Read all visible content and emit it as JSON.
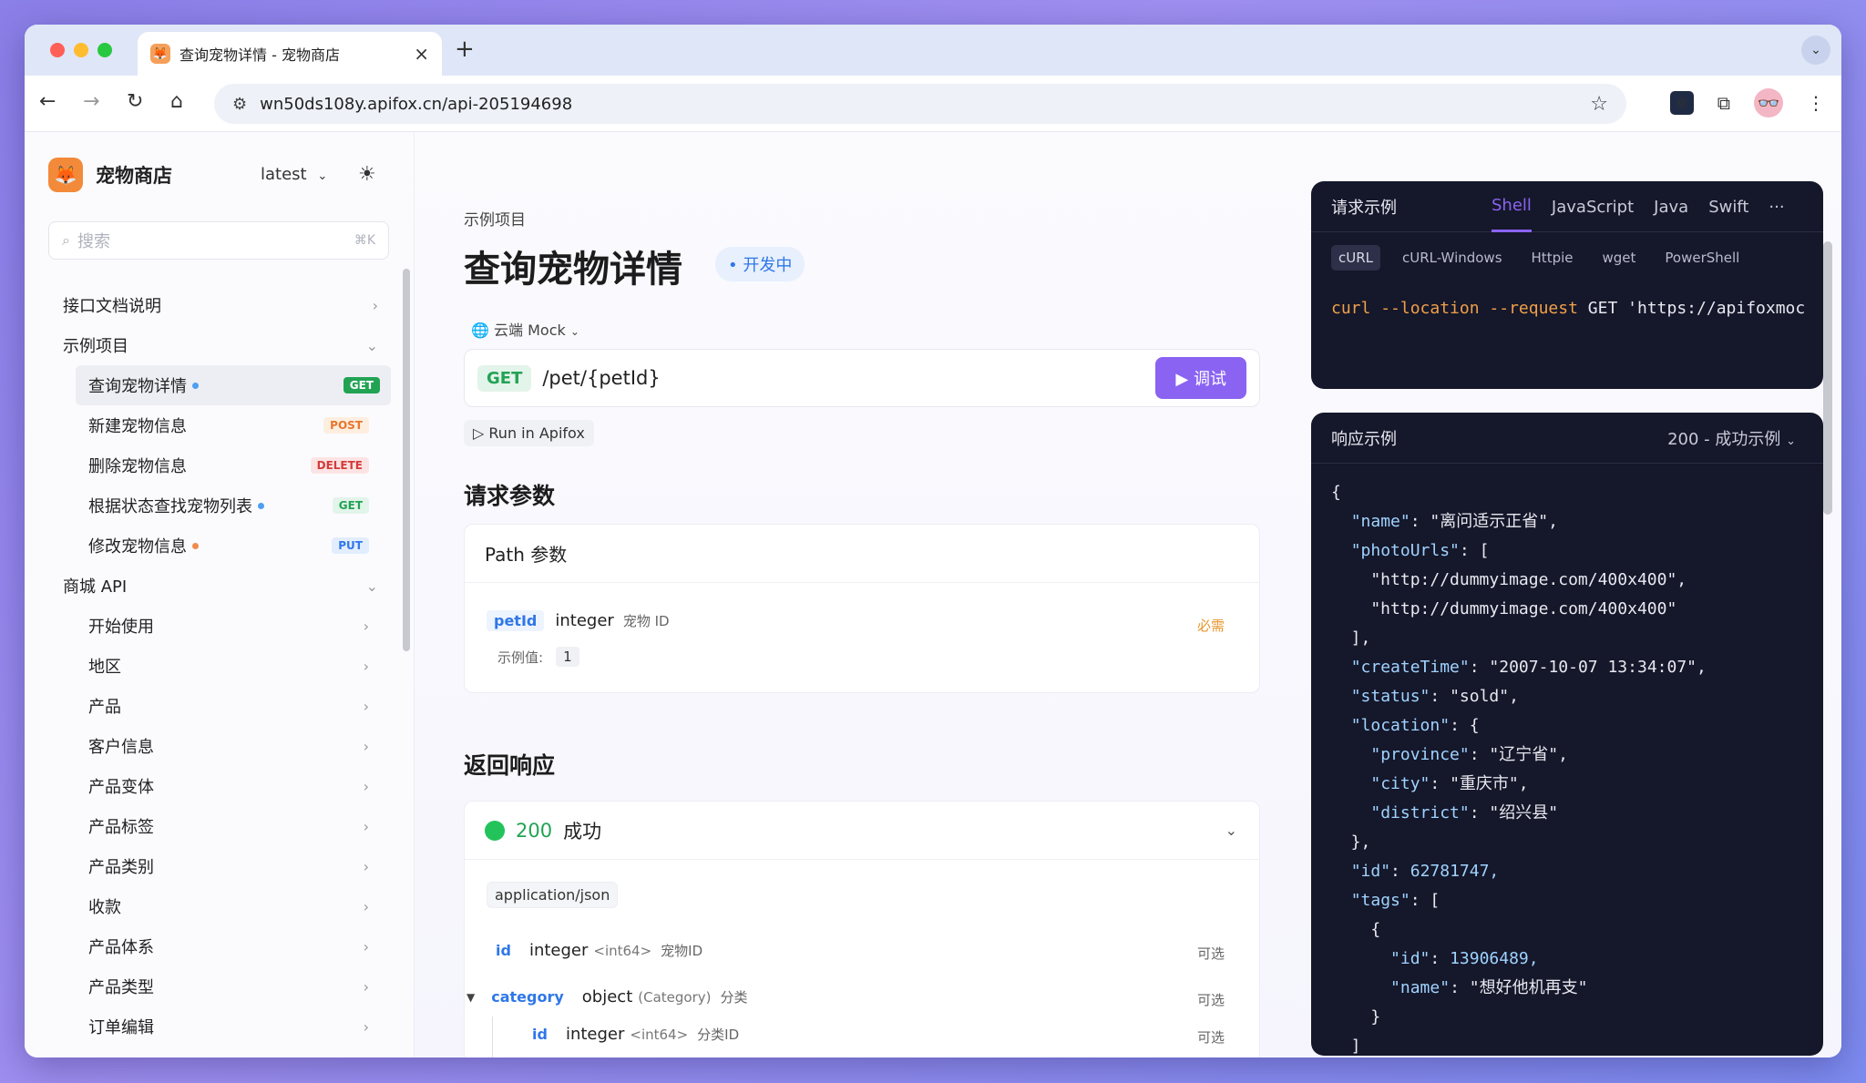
{
  "browser": {
    "tab_title": "查询宠物详情 - 宠物商店",
    "url": "wn50ds108y.apifox.cn/api-205194698"
  },
  "sidebar": {
    "brand": "宠物商店",
    "version": "latest",
    "search_placeholder": "搜索",
    "search_shortcut": "⌘K",
    "items": [
      {
        "label": "接口文档说明",
        "level": 0
      },
      {
        "label": "示例项目",
        "level": 0,
        "expanded": true
      },
      {
        "label": "查询宠物详情",
        "level": 1,
        "method": "GET",
        "dot": "#4d9ff0",
        "active": true
      },
      {
        "label": "新建宠物信息",
        "level": 1,
        "method": "POST"
      },
      {
        "label": "删除宠物信息",
        "level": 1,
        "method": "DELETE"
      },
      {
        "label": "根据状态查找宠物列表",
        "level": 1,
        "method": "GET",
        "dot": "#4d9ff0"
      },
      {
        "label": "修改宠物信息",
        "level": 1,
        "method": "PUT",
        "dot": "#f08a4d"
      },
      {
        "label": "商城 API",
        "level": 0,
        "expanded": true
      },
      {
        "label": "开始使用",
        "level": 1
      },
      {
        "label": "地区",
        "level": 1
      },
      {
        "label": "产品",
        "level": 1
      },
      {
        "label": "客户信息",
        "level": 1
      },
      {
        "label": "产品变体",
        "level": 1
      },
      {
        "label": "产品标签",
        "level": 1
      },
      {
        "label": "产品类别",
        "level": 1
      },
      {
        "label": "收款",
        "level": 1
      },
      {
        "label": "产品体系",
        "level": 1
      },
      {
        "label": "产品类型",
        "level": 1
      },
      {
        "label": "订单编辑",
        "level": 1
      }
    ]
  },
  "main": {
    "breadcrumb": "示例项目",
    "title": "查询宠物详情",
    "status": "开发中",
    "env": "云端 Mock",
    "method": "GET",
    "path": "/pet/{petId}",
    "debug_label": "调试",
    "run_label": "Run in Apifox",
    "req_params_title": "请求参数",
    "path_params_title": "Path 参数",
    "param": {
      "name": "petId",
      "type": "integer",
      "desc": "宠物 ID",
      "required": "必需",
      "example_label": "示例值:",
      "example": "1"
    },
    "response_title": "返回响应",
    "response_code": "200",
    "response_text": "成功",
    "content_type": "application/json",
    "fields": [
      {
        "name": "id",
        "type": "integer",
        "format": "<int64>",
        "desc": "宠物ID",
        "opt": "可选"
      },
      {
        "name": "category",
        "type": "object",
        "format": "(Category)",
        "desc": "分类",
        "opt": "可选"
      },
      {
        "name": "id",
        "type": "integer",
        "format": "<int64>",
        "desc": "分类ID",
        "opt": "可选"
      }
    ]
  },
  "request_example": {
    "title": "请求示例",
    "tabs": [
      "Shell",
      "JavaScript",
      "Java",
      "Swift"
    ],
    "active_tab": "Shell",
    "more": "···",
    "subtabs": [
      "cURL",
      "cURL-Windows",
      "Httpie",
      "wget",
      "PowerShell"
    ],
    "active_subtab": "cURL",
    "code": {
      "cmd": "curl",
      "flags": "--location --request",
      "verb": "GET",
      "url": "'https://apifoxmoc"
    }
  },
  "response_example": {
    "title": "响应示例",
    "selector": "200 - 成功示例",
    "lines": [
      "{",
      "  \"name\": \"离问适示正省\",",
      "  \"photoUrls\": [",
      "    \"http://dummyimage.com/400x400\",",
      "    \"http://dummyimage.com/400x400\"",
      "  ],",
      "  \"createTime\": \"2007-10-07 13:34:07\",",
      "  \"status\": \"sold\",",
      "  \"location\": {",
      "    \"province\": \"辽宁省\",",
      "    \"city\": \"重庆市\",",
      "    \"district\": \"绍兴县\"",
      "  },",
      "  \"id\": 62781747,",
      "  \"tags\": [",
      "    {",
      "      \"id\": 13906489,",
      "      \"name\": \"想好他机再支\"",
      "    }",
      "  ]"
    ]
  },
  "colors": {
    "accent": "#8a63f2",
    "get": "#22a354",
    "post": "#e8762c",
    "delete": "#d6393a",
    "put": "#2f77e8"
  }
}
